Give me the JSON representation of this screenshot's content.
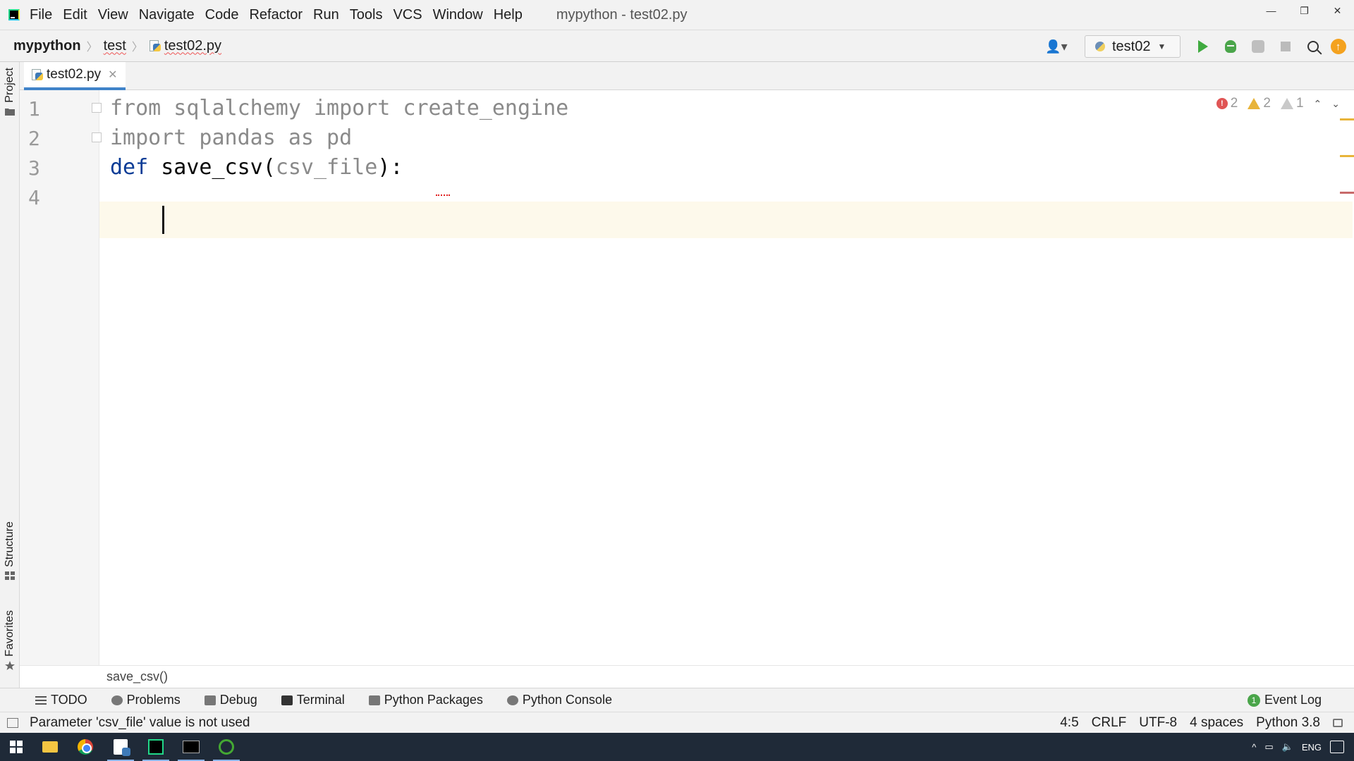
{
  "menubar": {
    "items": [
      "File",
      "Edit",
      "View",
      "Navigate",
      "Code",
      "Refactor",
      "Run",
      "Tools",
      "VCS",
      "Window",
      "Help"
    ],
    "window_title": "mypython - test02.py",
    "controls": [
      "—",
      "❐",
      "✕"
    ]
  },
  "navbar": {
    "project": "mypython",
    "folder": "test",
    "file": "test02.py",
    "run_config": "test02"
  },
  "side_tabs": {
    "project": "Project",
    "structure": "Structure",
    "favorites": "Favorites"
  },
  "editor": {
    "tab_label": "test02.py",
    "tab_close": "✕",
    "line_numbers": [
      "1",
      "2",
      "3",
      "4"
    ],
    "lines": {
      "l1": "from sqlalchemy import create_engine",
      "l2": "import pandas as pd",
      "l3_kw": "def",
      "l3_name": " save_csv(",
      "l3_param": "csv_file",
      "l3_end": "):"
    },
    "inspections": {
      "errors": "2",
      "warnings": "2",
      "weak_warnings": "1",
      "up": "⌃",
      "down": "⌄"
    }
  },
  "function_breadcrumb": "save_csv()",
  "tool_windows": {
    "todo": "TODO",
    "problems": "Problems",
    "debug": "Debug",
    "terminal": "Terminal",
    "python_packages": "Python Packages",
    "python_console": "Python Console",
    "event_log": "Event Log",
    "event_count": "1"
  },
  "statusbar": {
    "message": "Parameter 'csv_file' value is not used",
    "position": "4:5",
    "line_sep": "CRLF",
    "encoding": "UTF-8",
    "indent": "4 spaces",
    "interpreter": "Python 3.8"
  },
  "taskbar": {
    "tray_lang": "ENG",
    "tray_chevron": "^"
  },
  "colors": {
    "accent": "#4083c9",
    "keyword": "#0b3c96",
    "error": "#e05555",
    "warning": "#e8b43a"
  }
}
